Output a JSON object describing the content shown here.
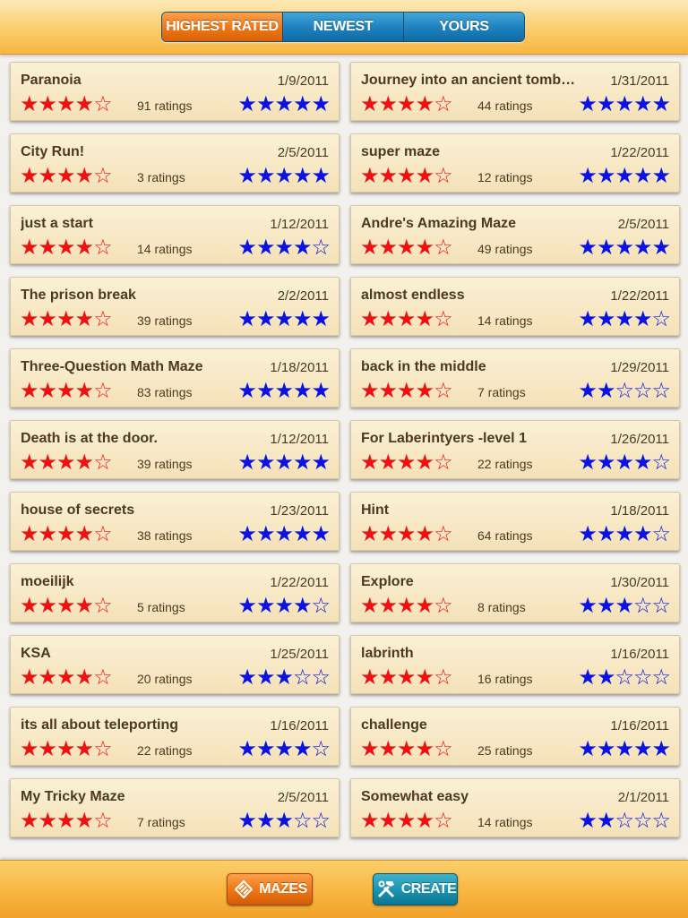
{
  "tabs": [
    {
      "label": "HIGHEST RATED",
      "active": true
    },
    {
      "label": "NEWEST",
      "active": false
    },
    {
      "label": "YOURS",
      "active": false
    }
  ],
  "mazes": [
    {
      "name": "Paranoia",
      "date": "1/9/2011",
      "ratings": "91 ratings",
      "user_stars": 4,
      "rating_stars": 5
    },
    {
      "name": "Journey into an ancient tomb…",
      "date": "1/31/2011",
      "ratings": "44 ratings",
      "user_stars": 4,
      "rating_stars": 5
    },
    {
      "name": "City Run!",
      "date": "2/5/2011",
      "ratings": "3 ratings",
      "user_stars": 4,
      "rating_stars": 5
    },
    {
      "name": "super maze",
      "date": "1/22/2011",
      "ratings": "12 ratings",
      "user_stars": 4,
      "rating_stars": 5
    },
    {
      "name": "just a start",
      "date": "1/12/2011",
      "ratings": "14 ratings",
      "user_stars": 4,
      "rating_stars": 4
    },
    {
      "name": "Andre's Amazing Maze",
      "date": "2/5/2011",
      "ratings": "49 ratings",
      "user_stars": 4,
      "rating_stars": 5
    },
    {
      "name": "The prison break",
      "date": "2/2/2011",
      "ratings": "39 ratings",
      "user_stars": 4,
      "rating_stars": 5
    },
    {
      "name": "almost endless",
      "date": "1/22/2011",
      "ratings": "14 ratings",
      "user_stars": 4,
      "rating_stars": 4
    },
    {
      "name": "Three-Question Math Maze",
      "date": "1/18/2011",
      "ratings": "83 ratings",
      "user_stars": 4,
      "rating_stars": 5
    },
    {
      "name": "back in the middle",
      "date": "1/29/2011",
      "ratings": "7 ratings",
      "user_stars": 4,
      "rating_stars": 2
    },
    {
      "name": "Death is at the door.",
      "date": "1/12/2011",
      "ratings": "39 ratings",
      "user_stars": 4,
      "rating_stars": 5
    },
    {
      "name": "For Laberintyers -level 1",
      "date": "1/26/2011",
      "ratings": "22 ratings",
      "user_stars": 4,
      "rating_stars": 4
    },
    {
      "name": "house of secrets",
      "date": "1/23/2011",
      "ratings": "38 ratings",
      "user_stars": 4,
      "rating_stars": 5
    },
    {
      "name": "Hint",
      "date": "1/18/2011",
      "ratings": "64 ratings",
      "user_stars": 4,
      "rating_stars": 4
    },
    {
      "name": "moeilijk",
      "date": "1/22/2011",
      "ratings": "5 ratings",
      "user_stars": 4,
      "rating_stars": 4
    },
    {
      "name": "Explore",
      "date": "1/30/2011",
      "ratings": "8 ratings",
      "user_stars": 4,
      "rating_stars": 3
    },
    {
      "name": "KSA",
      "date": "1/25/2011",
      "ratings": "20 ratings",
      "user_stars": 4,
      "rating_stars": 3
    },
    {
      "name": "labrinth",
      "date": "1/16/2011",
      "ratings": "16 ratings",
      "user_stars": 4,
      "rating_stars": 2
    },
    {
      "name": "its all about teleporting",
      "date": "1/16/2011",
      "ratings": "22 ratings",
      "user_stars": 4,
      "rating_stars": 4
    },
    {
      "name": "challenge",
      "date": "1/16/2011",
      "ratings": "25 ratings",
      "user_stars": 4,
      "rating_stars": 5
    },
    {
      "name": "My Tricky Maze",
      "date": "2/5/2011",
      "ratings": "7 ratings",
      "user_stars": 4,
      "rating_stars": 3
    },
    {
      "name": "Somewhat easy",
      "date": "2/1/2011",
      "ratings": "14 ratings",
      "user_stars": 4,
      "rating_stars": 2
    }
  ],
  "bottom": {
    "mazes_label": "MAZES",
    "mazes_icon": "maze-stack-icon",
    "create_label": "CREATE",
    "create_icon": "hammer-wrench-icon"
  },
  "colors": {
    "user_star": "#ee1111",
    "rating_star": "#0a13e3",
    "active_tab": "#f07a18",
    "tab": "#1e83bf"
  }
}
